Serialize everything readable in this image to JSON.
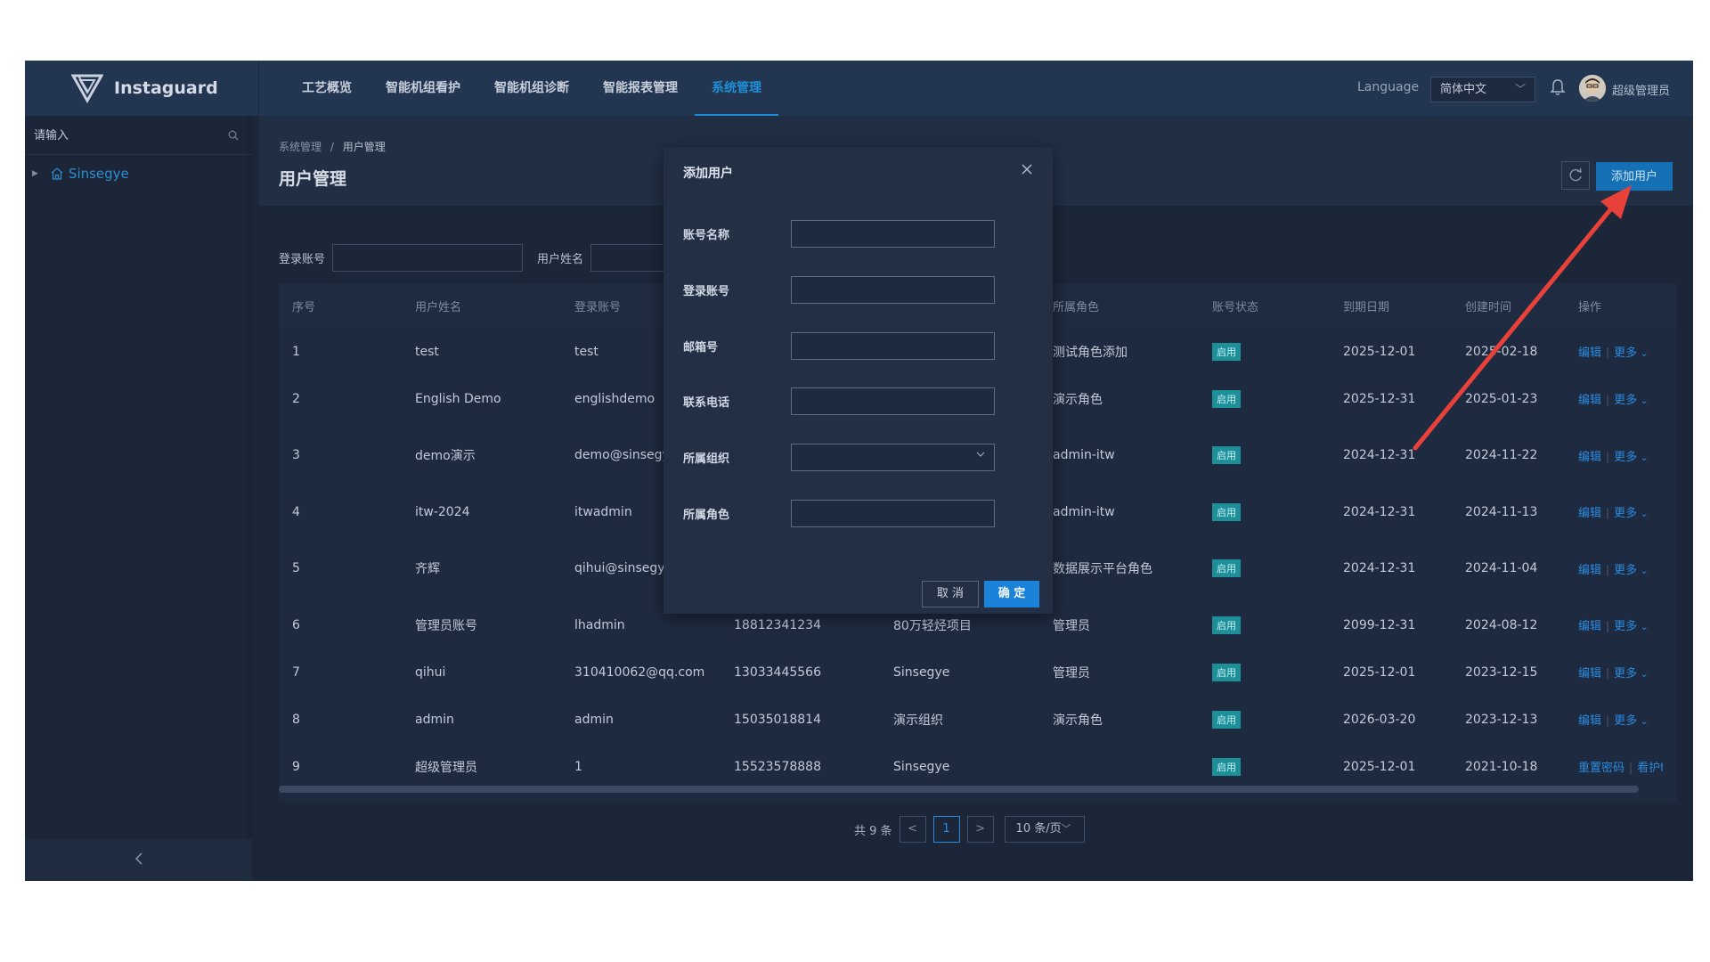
{
  "header": {
    "brand": "Instaguard",
    "nav": [
      {
        "label": "工艺概览"
      },
      {
        "label": "智能机组看护"
      },
      {
        "label": "智能机组诊断"
      },
      {
        "label": "智能报表管理"
      },
      {
        "label": "系统管理"
      }
    ],
    "active_nav": "系统管理",
    "language_label": "Language",
    "language_value": "简体中文",
    "user_name": "超级管理员"
  },
  "sidebar": {
    "search_placeholder": "请输入",
    "tree_root": "Sinsegye",
    "collapse_icon": "chevron-left-icon"
  },
  "page": {
    "breadcrumb_parent": "系统管理",
    "breadcrumb_sep": "/",
    "breadcrumb_current": "用户管理",
    "title": "用户管理",
    "add_button": "添加用户"
  },
  "filters": {
    "login_label": "登录账号",
    "name_label": "用户姓名"
  },
  "table": {
    "columns": [
      "序号",
      "用户姓名",
      "登录账号",
      "",
      "",
      "所属角色",
      "账号状态",
      "到期日期",
      "创建时间",
      "操作"
    ],
    "rows": [
      {
        "no": "1",
        "name": "test",
        "login": "test",
        "phone": "",
        "org": "",
        "role": "测试角色添加",
        "status": "启用",
        "expire": "2025-12-01",
        "created": "2025-02-18",
        "op1": "编辑",
        "op2": "更多"
      },
      {
        "no": "2",
        "name": "English Demo",
        "login": "englishdemo",
        "phone": "",
        "org": "",
        "role": "演示角色",
        "status": "启用",
        "expire": "2025-12-31",
        "created": "2025-01-23",
        "op1": "编辑",
        "op2": "更多"
      },
      {
        "no": "3",
        "name": "demo演示",
        "login": "demo@sinsegy cn",
        "phone": "",
        "org": "",
        "role": "admin-itw",
        "status": "启用",
        "expire": "2024-12-31",
        "created": "2024-11-22",
        "op1": "编辑",
        "op2": "更多"
      },
      {
        "no": "4",
        "name": "itw-2024",
        "login": "itwadmin",
        "phone": "",
        "org": "",
        "role": "admin-itw",
        "status": "启用",
        "expire": "2024-12-31",
        "created": "2024-11-13",
        "op1": "编辑",
        "op2": "更多"
      },
      {
        "no": "5",
        "name": "齐辉",
        "login": "qihui@sinsegye n",
        "phone": "",
        "org": "",
        "role": "数据展示平台角色",
        "status": "启用",
        "expire": "2024-12-31",
        "created": "2024-11-04",
        "op1": "编辑",
        "op2": "更多"
      },
      {
        "no": "6",
        "name": "管理员账号",
        "login": "lhadmin",
        "phone": "18812341234",
        "org": "80万轻烃项目",
        "role": "管理员",
        "status": "启用",
        "expire": "2099-12-31",
        "created": "2024-08-12",
        "op1": "编辑",
        "op2": "更多"
      },
      {
        "no": "7",
        "name": "qihui",
        "login": "310410062@qq.com",
        "phone": "13033445566",
        "org": "Sinsegye",
        "role": "管理员",
        "status": "启用",
        "expire": "2025-12-01",
        "created": "2023-12-15",
        "op1": "编辑",
        "op2": "更多"
      },
      {
        "no": "8",
        "name": "admin",
        "login": "admin",
        "phone": "15035018814",
        "org": "演示组织",
        "role": "演示角色",
        "status": "启用",
        "expire": "2026-03-20",
        "created": "2023-12-13",
        "op1": "编辑",
        "op2": "更多"
      },
      {
        "no": "9",
        "name": "超级管理员",
        "login": "1",
        "phone": "15523578888",
        "org": "Sinsegye",
        "role": "",
        "status": "启用",
        "expire": "2025-12-01",
        "created": "2021-10-18",
        "op1": "重置密码",
        "op2": "看护t"
      }
    ]
  },
  "pagination": {
    "total": "共 9 条",
    "prev": "<",
    "current": "1",
    "next": ">",
    "page_size": "10 条/页"
  },
  "modal": {
    "title": "添加用户",
    "fields": [
      {
        "label": "账号名称",
        "type": "text"
      },
      {
        "label": "登录账号",
        "type": "text"
      },
      {
        "label": "邮箱号",
        "type": "text"
      },
      {
        "label": "联系电话",
        "type": "text"
      },
      {
        "label": "所属组织",
        "type": "select"
      },
      {
        "label": "所属角色",
        "type": "text"
      }
    ],
    "cancel": "取 消",
    "ok": "确 定"
  },
  "colors": {
    "accent": "#1e8fd6",
    "primary_button": "#1a82d9",
    "status_badge": "#1d8f99",
    "annotation_arrow": "#e8413a"
  }
}
